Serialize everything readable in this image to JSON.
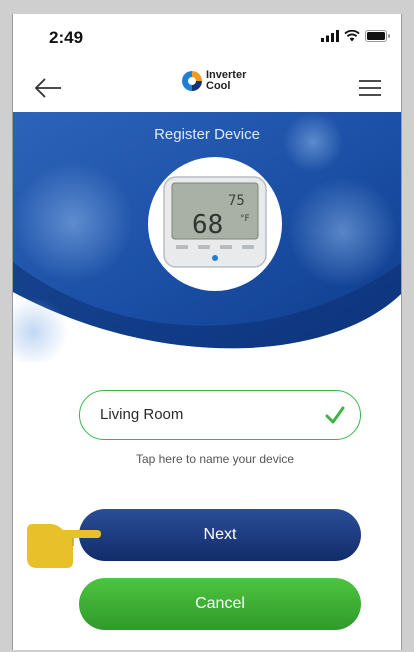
{
  "status_bar": {
    "time": "2:49"
  },
  "header": {
    "logo_line1": "Inverter",
    "logo_line2": "Cool",
    "back_icon": "arrow-left-icon",
    "menu_icon": "hamburger-menu-icon"
  },
  "hero": {
    "title": "Register Device",
    "device": {
      "display_top": "75",
      "display_main": "68",
      "unit": "°F"
    }
  },
  "device_name": {
    "value": "Living Room",
    "hint": "Tap here to name your device",
    "valid": true
  },
  "actions": {
    "next_label": "Next",
    "cancel_label": "Cancel"
  },
  "colors": {
    "primary_blue": "#1a3678",
    "accent_green": "#3bb54a",
    "hero_blue": "#1b4ea8",
    "pointer_yellow": "#e8c12a"
  }
}
